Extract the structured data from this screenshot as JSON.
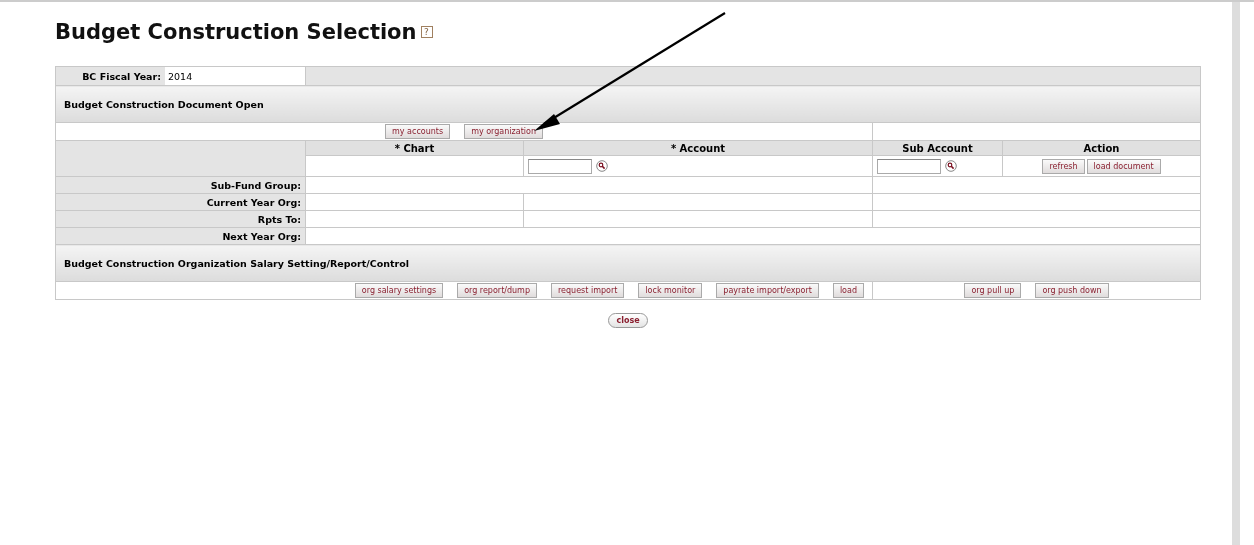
{
  "page": {
    "title": "Budget Construction Selection",
    "help_icon": "?"
  },
  "fiscal_year": {
    "label": "BC Fiscal Year:",
    "value": "2014"
  },
  "document_open": {
    "title": "Budget Construction Document Open",
    "buttons": [
      "my accounts",
      "my organization"
    ],
    "columns": [
      "* Chart",
      "* Account",
      "Sub Account",
      "Action"
    ],
    "action_buttons": [
      "refresh",
      "load document"
    ],
    "info_rows": [
      {
        "label": "Sub-Fund Group:",
        "kind": "split2"
      },
      {
        "label": "Current Year Org:",
        "kind": "split3"
      },
      {
        "label": "Rpts To:",
        "kind": "split3"
      },
      {
        "label": "Next Year Org:",
        "kind": "full"
      }
    ]
  },
  "salary_setting": {
    "title": "Budget Construction Organization Salary Setting/Report/Control",
    "buttons": [
      "org salary settings",
      "org report/dump",
      "request import",
      "lock monitor",
      "payrate import/export",
      "load"
    ],
    "right_buttons": [
      "org pull up",
      "org push down"
    ]
  },
  "close_button": "close"
}
